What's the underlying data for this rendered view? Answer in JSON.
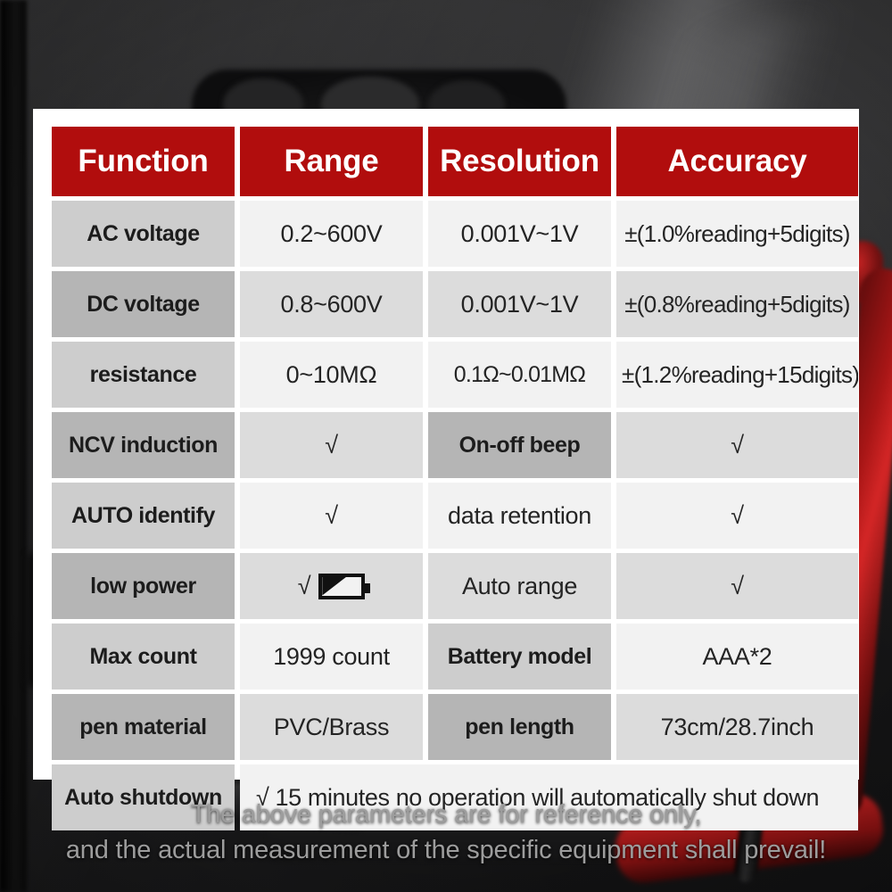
{
  "table": {
    "headers": [
      {
        "label": "Function"
      },
      {
        "label": "Range"
      },
      {
        "label": "Resolution"
      },
      {
        "label": "Accuracy"
      }
    ],
    "rows": [
      {
        "function": "AC voltage",
        "range": "0.2~600V",
        "resolution": "0.001V~1V",
        "accuracy": "±(1.0%reading+5digits)"
      },
      {
        "function": "DC voltage",
        "range": "0.8~600V",
        "resolution": "0.001V~1V",
        "accuracy": "±(0.8%reading+5digits)"
      },
      {
        "function": "resistance",
        "range": "0~10MΩ",
        "resolution": "0.1Ω~0.01MΩ",
        "accuracy": "±(1.2%reading+15digits)"
      },
      {
        "function": "NCV induction",
        "range": "√",
        "resolution": "On-off beep",
        "accuracy": "√"
      },
      {
        "function": "AUTO identify",
        "range": "√",
        "resolution": "data retention",
        "accuracy": "√"
      },
      {
        "function": "low power",
        "range": "√",
        "range_icon": "low-battery-icon",
        "resolution": "Auto range",
        "accuracy": "√"
      },
      {
        "function": "Max count",
        "range": "1999 count",
        "resolution": "Battery model",
        "accuracy": "AAA*2"
      },
      {
        "function": "pen material",
        "range": "PVC/Brass",
        "resolution": "pen length",
        "accuracy": "73cm/28.7inch"
      }
    ],
    "footer_row": {
      "function": "Auto shutdown",
      "value": "√ 15 minutes no operation will automatically shut down"
    }
  },
  "caption": {
    "line1": "The above parameters are for reference only,",
    "line2": "and the actual measurement of the specific equipment shall prevail!"
  },
  "colors": {
    "header_red": "#b10d0d",
    "card_white": "#ffffff",
    "label_light": "#cdcdcd",
    "label_dark": "#b5b5b5",
    "value_light": "#f2f2f2",
    "value_dark": "#dcdcdc",
    "caption_gray": "#9d9d9d"
  }
}
